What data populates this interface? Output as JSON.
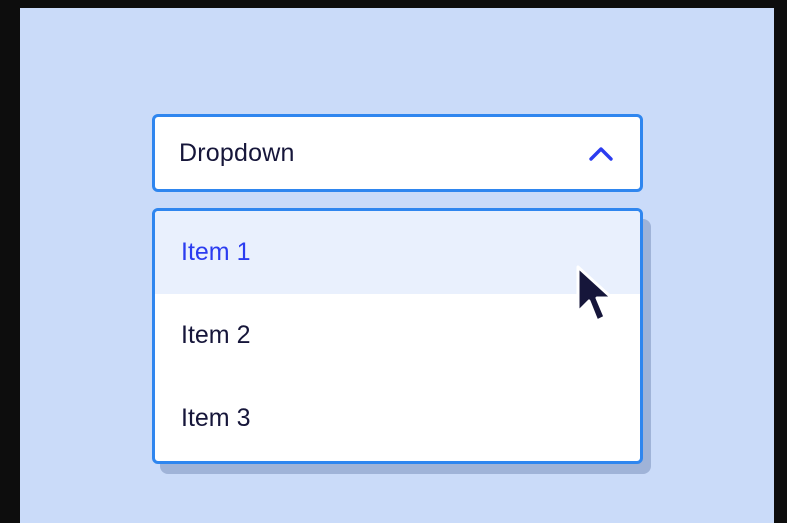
{
  "dropdown": {
    "label": "Dropdown",
    "state": "open",
    "toggle_icon": "chevron-up-icon",
    "items": [
      {
        "label": "Item 1",
        "highlighted": true
      },
      {
        "label": "Item 2",
        "highlighted": false
      },
      {
        "label": "Item 3",
        "highlighted": false
      }
    ]
  },
  "pointer": {
    "icon": "mouse-cursor-icon"
  },
  "colors": {
    "background": "#cadbf9",
    "accent_border": "#2f86ef",
    "highlight_text": "#2b3cf0",
    "highlight_bg": "#e9f0fd",
    "text": "#16163a"
  }
}
